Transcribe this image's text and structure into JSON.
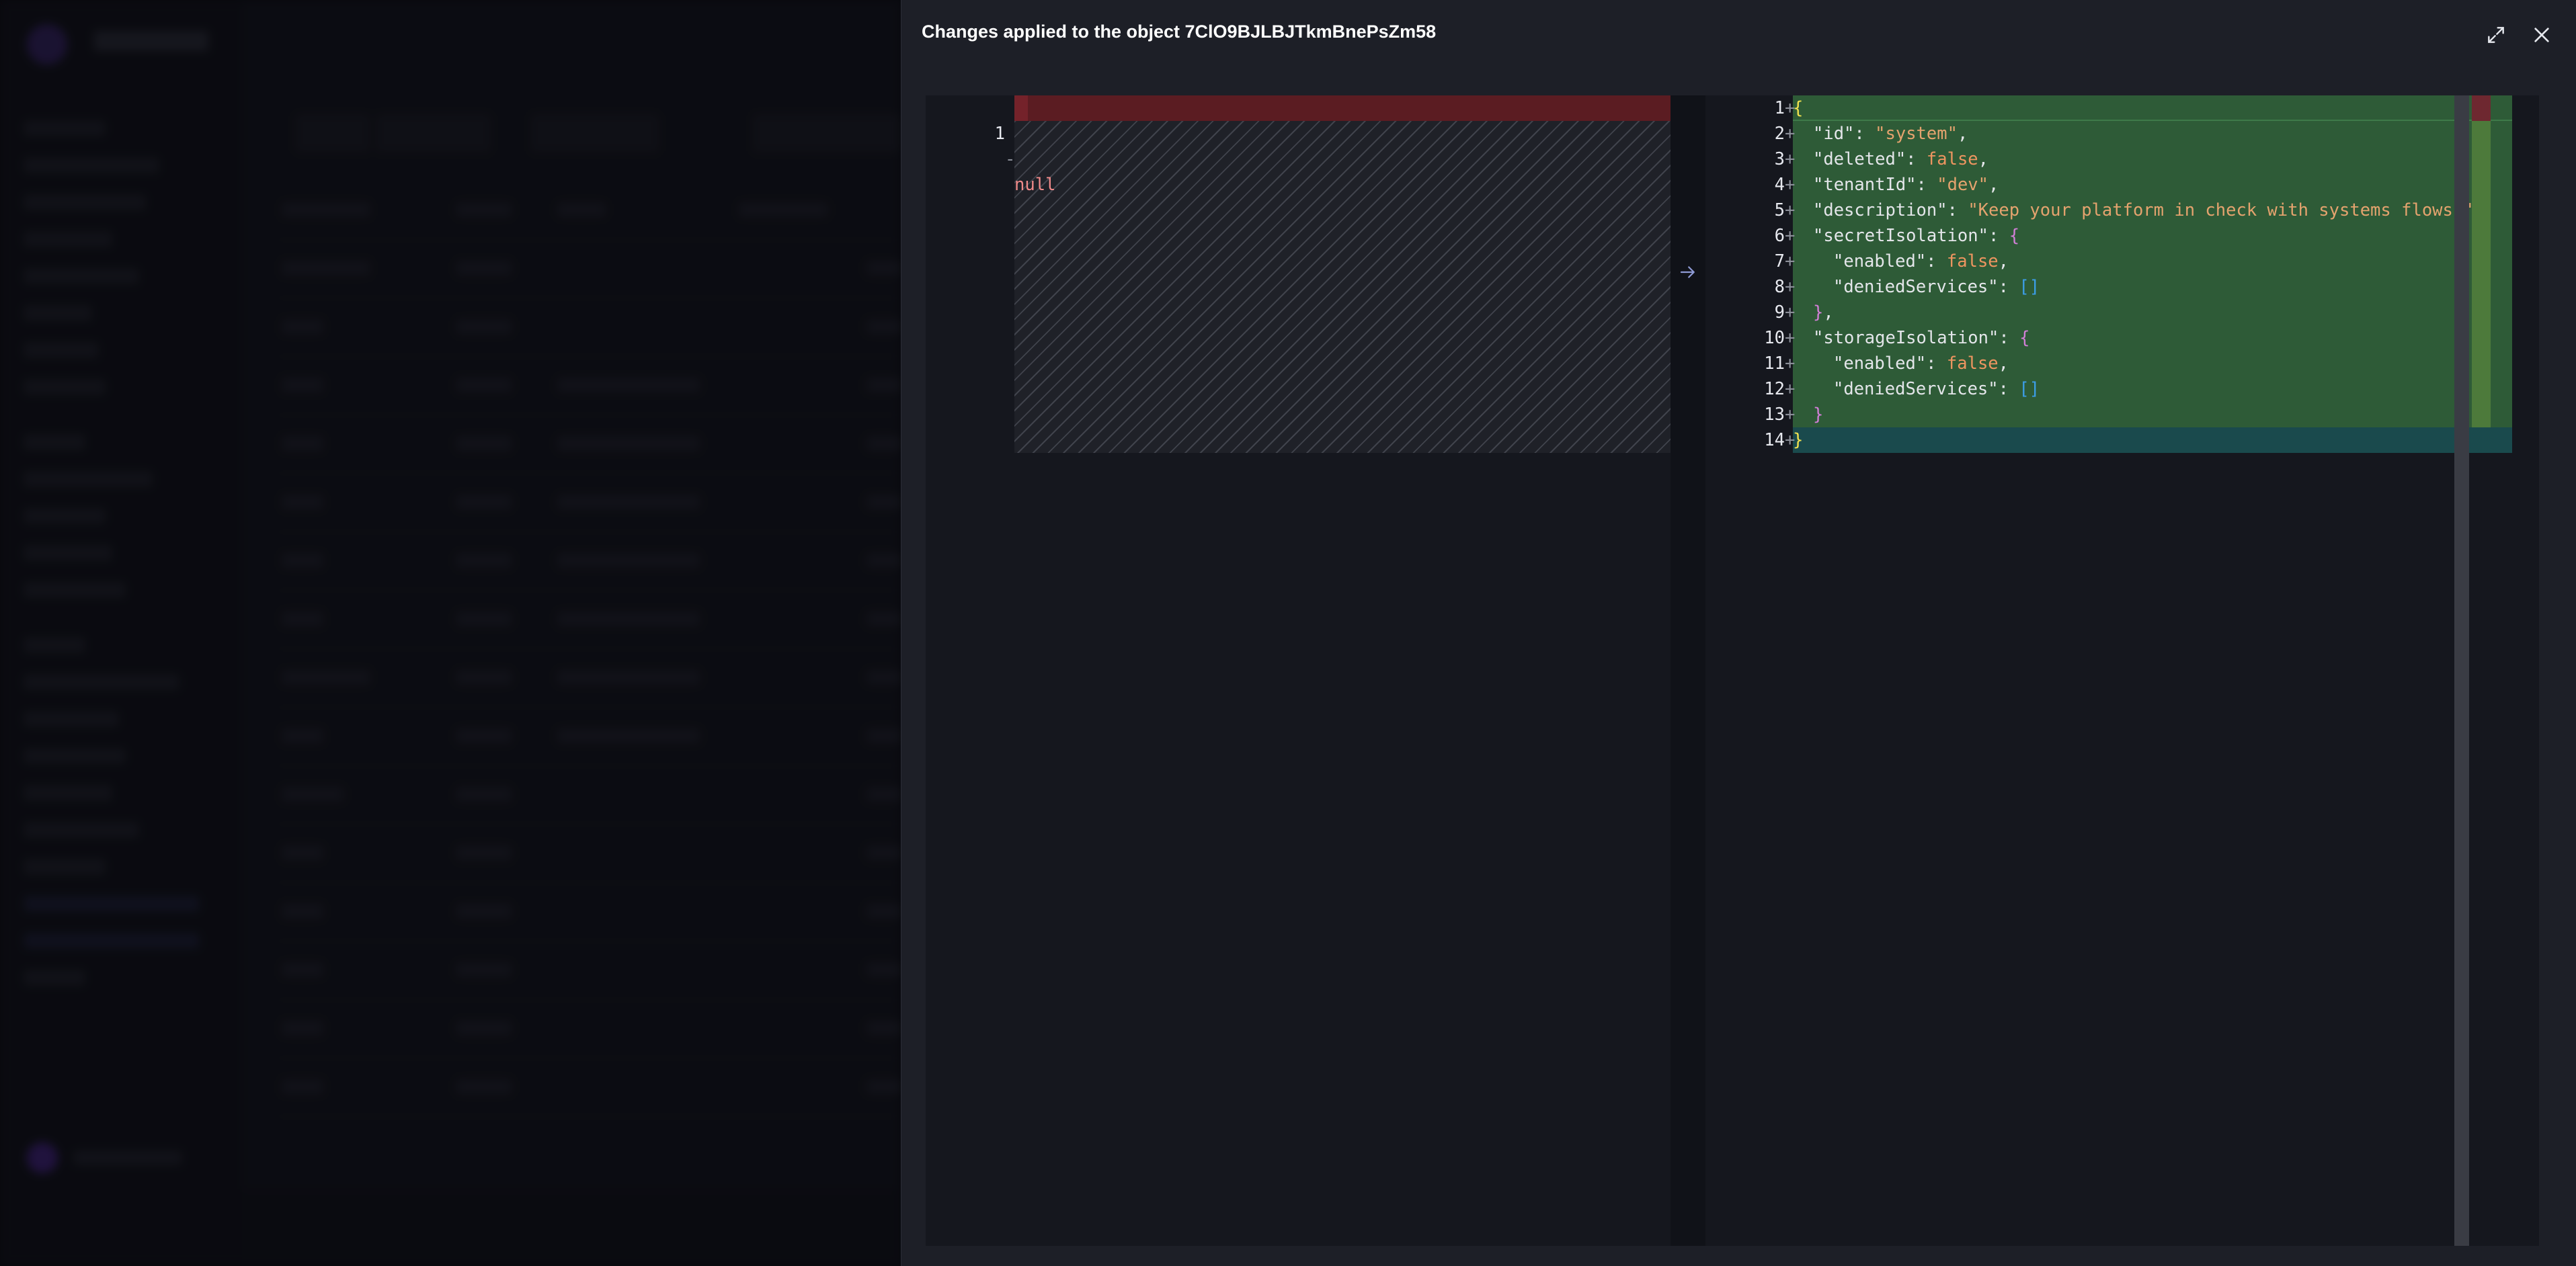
{
  "drawer": {
    "title": "Changes applied to the object 7ClO9BJLBJTkmBnePsZm58",
    "icons": {
      "expand": "expand-icon",
      "close": "close-icon",
      "arrow": "arrow-right-icon"
    }
  },
  "diff": {
    "left": {
      "lines": [
        {
          "num": "1",
          "marker": "-",
          "text": "null"
        }
      ]
    },
    "right": {
      "lines": [
        {
          "num": "1",
          "marker": "+"
        },
        {
          "num": "2",
          "marker": "+"
        },
        {
          "num": "3",
          "marker": "+"
        },
        {
          "num": "4",
          "marker": "+"
        },
        {
          "num": "5",
          "marker": "+"
        },
        {
          "num": "6",
          "marker": "+"
        },
        {
          "num": "7",
          "marker": "+"
        },
        {
          "num": "8",
          "marker": "+"
        },
        {
          "num": "9",
          "marker": "+"
        },
        {
          "num": "10",
          "marker": "+"
        },
        {
          "num": "11",
          "marker": "+"
        },
        {
          "num": "12",
          "marker": "+"
        },
        {
          "num": "13",
          "marker": "+"
        },
        {
          "num": "14",
          "marker": "+"
        }
      ],
      "tokens": {
        "brace_open": "{",
        "brace_close": "}",
        "colon": ": ",
        "comma": ",",
        "empty_array": "[]",
        "k_id": "\"id\"",
        "v_id": "\"system\"",
        "k_deleted": "\"deleted\"",
        "v_deleted": "false",
        "k_tenant": "\"tenantId\"",
        "v_tenant": "\"dev\"",
        "k_desc": "\"description\"",
        "v_desc": "\"Keep your platform in check with systems flows.\"",
        "k_secret": "\"secretIsolation\"",
        "k_enabled": "\"enabled\"",
        "v_false": "false",
        "k_denied": "\"deniedServices\"",
        "k_storage": "\"storageIsolation\""
      }
    }
  },
  "colors": {
    "removed": "#5b1c22",
    "added": "#2e5b37",
    "added_last": "#1a4a4d",
    "drawer_bg": "#1d1f27"
  }
}
